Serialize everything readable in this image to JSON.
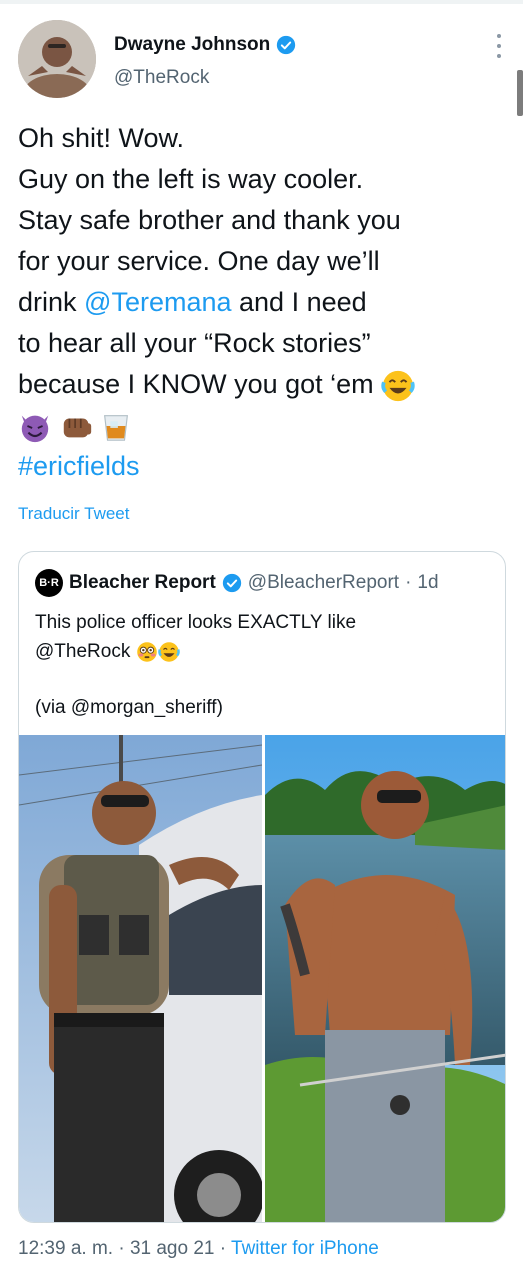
{
  "author": {
    "name": "Dwayne Johnson",
    "handle": "@TheRock",
    "verified": true
  },
  "tweet": {
    "lines": [
      "Oh shit! Wow.",
      "Guy on the left is way cooler.",
      "Stay safe brother and thank you",
      "for your service. One day we’ll"
    ],
    "line5_before": "drink ",
    "line5_mention": "@Teremana",
    "line5_after": " and I need",
    "line6": "to hear all your “Rock stories”",
    "line7": "because I KNOW you got ‘em",
    "hashtag": "#ericfields",
    "emojis_line7": [
      "face-with-tears-of-joy"
    ],
    "emojis_line8": [
      "smiling-face-with-horns",
      "oncoming-fist",
      "tumbler-glass"
    ]
  },
  "translate_label": "Traducir Tweet",
  "quoted_tweet": {
    "logo_text": "B·R",
    "name": "Bleacher Report",
    "verified": true,
    "handle": "@BleacherReport",
    "separator": "·",
    "time": "1d",
    "text_line1": "This police officer looks EXACTLY like",
    "text_line2_mention": "@TheRock",
    "emojis": [
      "flushed-face",
      "face-with-tears-of-joy"
    ],
    "via": "(via @morgan_sheriff)",
    "photos": [
      {
        "description": "police-officer-photo"
      },
      {
        "description": "the-rock-shirtless-photo"
      }
    ]
  },
  "footer": {
    "time": "12:39 a. m.",
    "separator1": " · ",
    "date": "31 ago 21",
    "separator2": " · ",
    "source": "Twitter for iPhone"
  },
  "colors": {
    "link": "#1d9bf0",
    "secondary_text": "#536471",
    "border": "#cfd9de"
  }
}
